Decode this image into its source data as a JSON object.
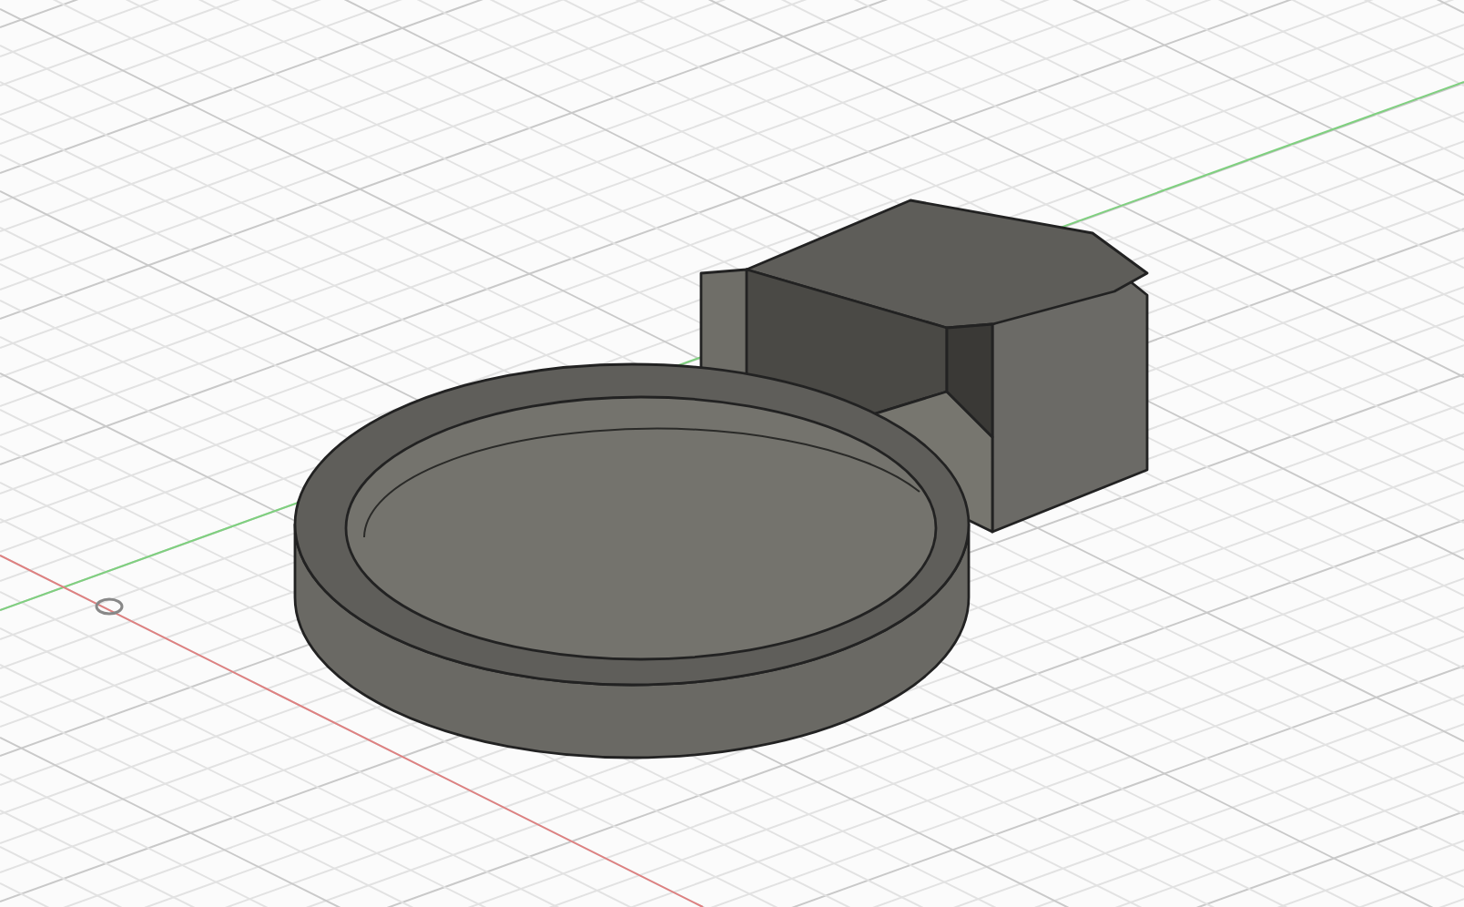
{
  "viewport": {
    "kind": "cad-3d",
    "show_grid": true,
    "show_axes": true,
    "show_origin": true
  }
}
